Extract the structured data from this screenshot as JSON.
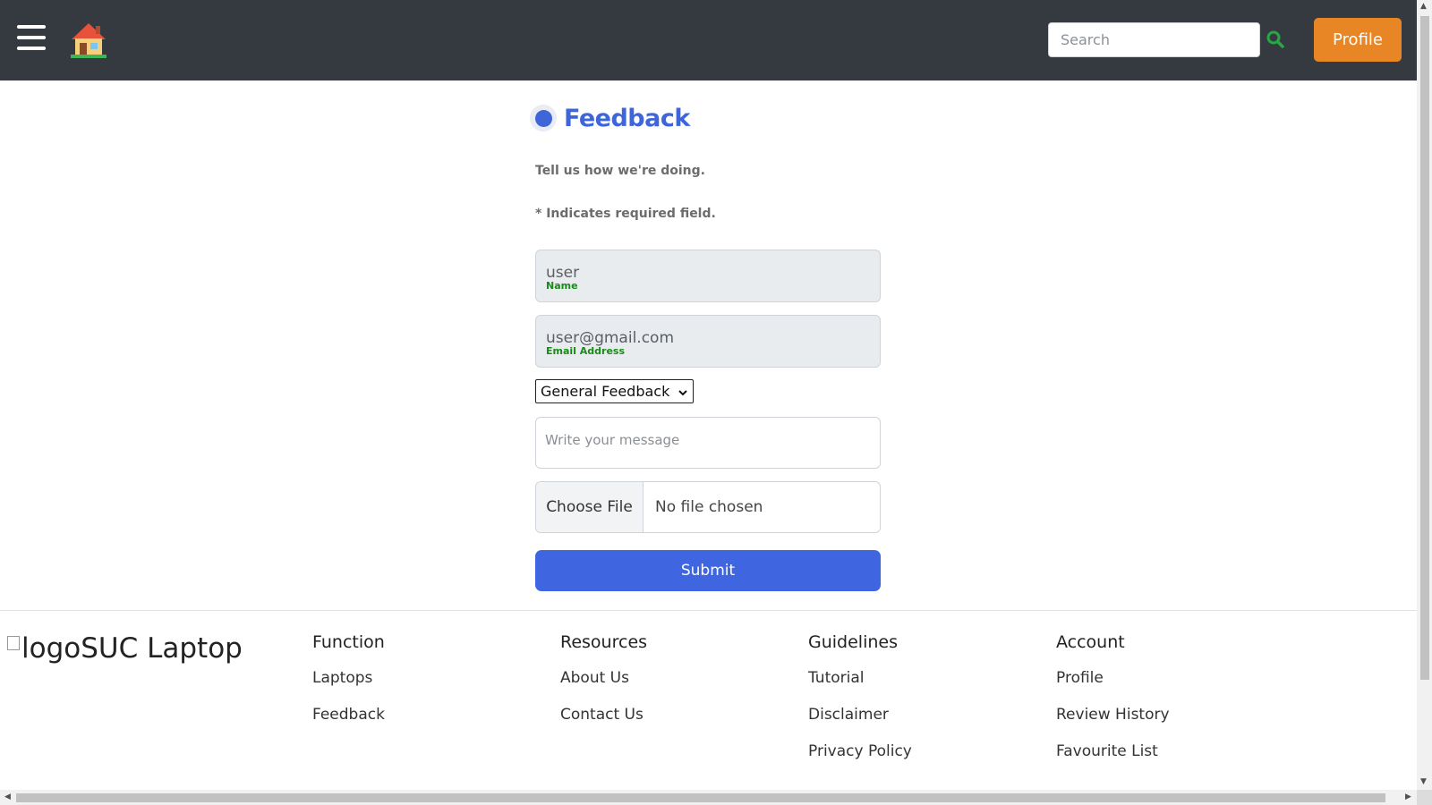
{
  "header": {
    "menu_icon": "hamburger-menu-icon",
    "home_icon": "house-icon",
    "search_placeholder": "Search",
    "search_icon": "magnifier-icon",
    "profile_label": "Profile"
  },
  "form": {
    "title": "Feedback",
    "tagline": "Tell us how we're doing.",
    "required_note": "* Indicates required field.",
    "name_value": "user",
    "name_label": "Name",
    "email_value": "user@gmail.com",
    "email_label": "Email Address",
    "feedback_type": "General Feedback",
    "message_placeholder": "Write your message",
    "file_button": "Choose File",
    "file_status": "No file chosen",
    "submit_label": "Submit"
  },
  "footer": {
    "logo_alt": "logo",
    "brand": "SUC Laptop",
    "columns": [
      {
        "heading": "Function",
        "links": [
          "Laptops",
          "Feedback"
        ]
      },
      {
        "heading": "Resources",
        "links": [
          "About Us",
          "Contact Us"
        ]
      },
      {
        "heading": "Guidelines",
        "links": [
          "Tutorial",
          "Disclaimer",
          "Privacy Policy"
        ]
      },
      {
        "heading": "Account",
        "links": [
          "Profile",
          "Review History",
          "Favourite List"
        ]
      }
    ]
  },
  "colors": {
    "header_bg": "#343a40",
    "accent_orange": "#e88524",
    "primary_blue": "#3f66e0",
    "label_green": "#1a8a1a",
    "search_icon_green": "#28a745"
  }
}
